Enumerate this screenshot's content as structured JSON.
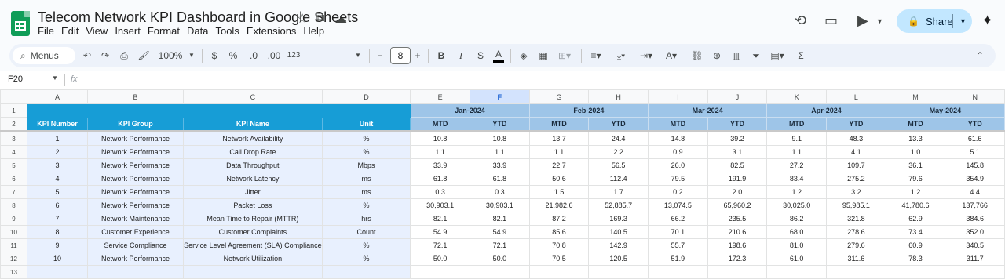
{
  "app": {
    "title": "Telecom Network KPI Dashboard in Google Sheets",
    "menu": [
      "File",
      "Edit",
      "View",
      "Insert",
      "Format",
      "Data",
      "Tools",
      "Extensions",
      "Help"
    ],
    "share_label": "Share"
  },
  "toolbar": {
    "menus_label": "Menus",
    "zoom": "100%",
    "currency": "$",
    "percent": "%",
    "dec_decrease": ".0",
    "dec_increase": ".00",
    "number_format": "123",
    "font_size": "8"
  },
  "formula_bar": {
    "cell_ref": "F20",
    "fx": "fx",
    "value": ""
  },
  "sheet": {
    "selected_column": "F",
    "columns": [
      "A",
      "B",
      "C",
      "D",
      "E",
      "F",
      "G",
      "H",
      "I",
      "J",
      "K",
      "L",
      "M",
      "N"
    ],
    "months": [
      "Jan-2024",
      "Feb-2024",
      "Mar-2024",
      "Apr-2024",
      "May-2024"
    ],
    "headers": {
      "kpi_number": "KPI Number",
      "kpi_group": "KPI Group",
      "kpi_name": "KPI Name",
      "unit": "Unit",
      "mtd": "MTD",
      "ytd": "YTD"
    },
    "row_numbers": [
      "1",
      "2",
      "3",
      "4",
      "5",
      "6",
      "7",
      "8",
      "9",
      "10",
      "11",
      "12",
      "13"
    ],
    "rows": [
      {
        "n": "1",
        "group": "Network Performance",
        "name": "Network Availability",
        "unit": "%",
        "vals": [
          "10.8",
          "10.8",
          "13.7",
          "24.4",
          "14.8",
          "39.2",
          "9.1",
          "48.3",
          "13.3",
          "61.6"
        ]
      },
      {
        "n": "2",
        "group": "Network Performance",
        "name": "Call Drop Rate",
        "unit": "%",
        "vals": [
          "1.1",
          "1.1",
          "1.1",
          "2.2",
          "0.9",
          "3.1",
          "1.1",
          "4.1",
          "1.0",
          "5.1"
        ]
      },
      {
        "n": "3",
        "group": "Network Performance",
        "name": "Data Throughput",
        "unit": "Mbps",
        "vals": [
          "33.9",
          "33.9",
          "22.7",
          "56.5",
          "26.0",
          "82.5",
          "27.2",
          "109.7",
          "36.1",
          "145.8"
        ]
      },
      {
        "n": "4",
        "group": "Network Performance",
        "name": "Network Latency",
        "unit": "ms",
        "vals": [
          "61.8",
          "61.8",
          "50.6",
          "112.4",
          "79.5",
          "191.9",
          "83.4",
          "275.2",
          "79.6",
          "354.9"
        ]
      },
      {
        "n": "5",
        "group": "Network Performance",
        "name": "Jitter",
        "unit": "ms",
        "vals": [
          "0.3",
          "0.3",
          "1.5",
          "1.7",
          "0.2",
          "2.0",
          "1.2",
          "3.2",
          "1.2",
          "4.4"
        ]
      },
      {
        "n": "6",
        "group": "Network Performance",
        "name": "Packet Loss",
        "unit": "%",
        "vals": [
          "30,903.1",
          "30,903.1",
          "21,982.6",
          "52,885.7",
          "13,074.5",
          "65,960.2",
          "30,025.0",
          "95,985.1",
          "41,780.6",
          "137,766"
        ]
      },
      {
        "n": "7",
        "group": "Network Maintenance",
        "name": "Mean Time to Repair (MTTR)",
        "unit": "hrs",
        "vals": [
          "82.1",
          "82.1",
          "87.2",
          "169.3",
          "66.2",
          "235.5",
          "86.2",
          "321.8",
          "62.9",
          "384.6"
        ]
      },
      {
        "n": "8",
        "group": "Customer Experience",
        "name": "Customer Complaints",
        "unit": "Count",
        "vals": [
          "54.9",
          "54.9",
          "85.6",
          "140.5",
          "70.1",
          "210.6",
          "68.0",
          "278.6",
          "73.4",
          "352.0"
        ]
      },
      {
        "n": "9",
        "group": "Service Compliance",
        "name": "Service Level Agreement (SLA) Compliance",
        "unit": "%",
        "vals": [
          "72.1",
          "72.1",
          "70.8",
          "142.9",
          "55.7",
          "198.6",
          "81.0",
          "279.6",
          "60.9",
          "340.5"
        ]
      },
      {
        "n": "10",
        "group": "Network Performance",
        "name": "Network Utilization",
        "unit": "%",
        "vals": [
          "50.0",
          "50.0",
          "70.5",
          "120.5",
          "51.9",
          "172.3",
          "61.0",
          "311.6",
          "78.3",
          "311.7"
        ]
      }
    ]
  }
}
